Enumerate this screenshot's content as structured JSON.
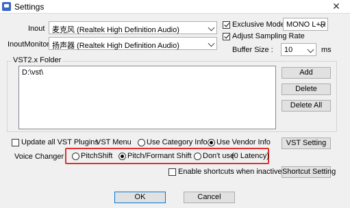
{
  "window": {
    "title": "Settings"
  },
  "devices": {
    "input_label": "Inout",
    "input_value": "麦克风 (Realtek High Definition Audio)",
    "monitor_label": "InoutMonitor",
    "monitor_value": "扬声器 (Realtek High Definition Audio)"
  },
  "options": {
    "exclusive_mode_label": "Exclusive Mode",
    "exclusive_mode_checked": true,
    "channel_value": "MONO L+R",
    "adjust_sampling_label": "Adjust Sampling Rate",
    "adjust_sampling_checked": true,
    "buffer_label": "Buffer Size :",
    "buffer_value": "10",
    "buffer_unit": "ms"
  },
  "vst_folder": {
    "title": "VST2.x Folder",
    "items": [
      "D:\\vst\\"
    ],
    "add_label": "Add",
    "delete_label": "Delete",
    "delete_all_label": "Delete All"
  },
  "vst_options": {
    "update_all_label": "Update all VST Plugins",
    "update_all_checked": false,
    "vst_menu_label": "VST Menu",
    "use_category_label": "Use Category Info",
    "use_vendor_label": "Use Vendor Info",
    "selected_menu": "vendor",
    "vst_setting_label": "VST Setting"
  },
  "voice_changer": {
    "label": "Voice Changer",
    "pitchshift_label": "PitchShift",
    "formant_label": "Pitch/Formant Shift",
    "dontuse_label": "Don't use",
    "latency_label": "(0 Latency)",
    "selected": "formant",
    "highlight_color": "#e03030"
  },
  "shortcuts": {
    "enable_label": "Enable shortcuts when inactive",
    "enable_checked": false,
    "shortcut_setting_label": "Shortcut Setting"
  },
  "footer": {
    "ok_label": "OK",
    "cancel_label": "Cancel"
  }
}
